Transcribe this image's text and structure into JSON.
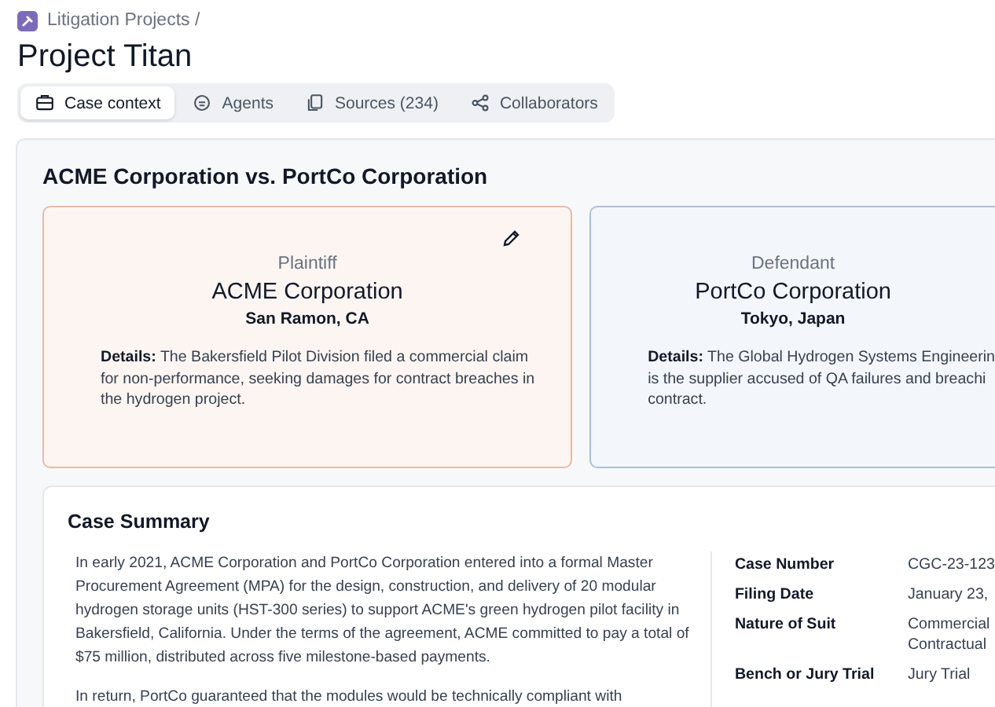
{
  "breadcrumb": "Litigation Projects /",
  "title": "Project Titan",
  "tabs": [
    {
      "label": "Case context",
      "selected": true
    },
    {
      "label": "Agents",
      "selected": false
    },
    {
      "label": "Sources (234)",
      "selected": false
    },
    {
      "label": "Collaborators",
      "selected": false
    }
  ],
  "case_title": "ACME Corporation vs. PortCo Corporation",
  "parties": [
    {
      "kind": "plaintiff",
      "role": "Plaintiff",
      "name": "ACME Corporation",
      "location": "San Ramon, CA",
      "details_label": "Details:",
      "details": "The Bakersfield Pilot Division filed a commercial claim for non-performance, seeking damages for contract breaches in the hydrogen project.",
      "editable": true
    },
    {
      "kind": "defendant",
      "role": "Defendant",
      "name": "PortCo Corporation",
      "location": "Tokyo, Japan",
      "details_label": "Details:",
      "details": "The Global Hydrogen Systems Engineerin\nis the supplier accused of QA failures and breachi\ncontract.",
      "editable": false
    }
  ],
  "summary": {
    "title": "Case Summary",
    "paragraphs": [
      "In early 2021, ACME Corporation and PortCo Corporation entered into a formal Master Procurement Agreement (MPA) for the design, construction, and delivery of 20 modular hydrogen storage units (HST-300 series) to support ACME's green hydrogen pilot facility in Bakersfield, California. Under the terms of the agreement, ACME committed to pay a total of $75 million, distributed across five milestone-based payments.",
      "In return, PortCo guaranteed that the modules would be technically compliant with"
    ],
    "fields": [
      {
        "label": "Case Number",
        "value": "CGC-23-123"
      },
      {
        "label": "Filing Date",
        "value": "January 23,"
      },
      {
        "label": "Nature of Suit",
        "value": "Commercial\nContractual"
      },
      {
        "label": "Bench or Jury Trial",
        "value": "Jury Trial"
      }
    ]
  }
}
